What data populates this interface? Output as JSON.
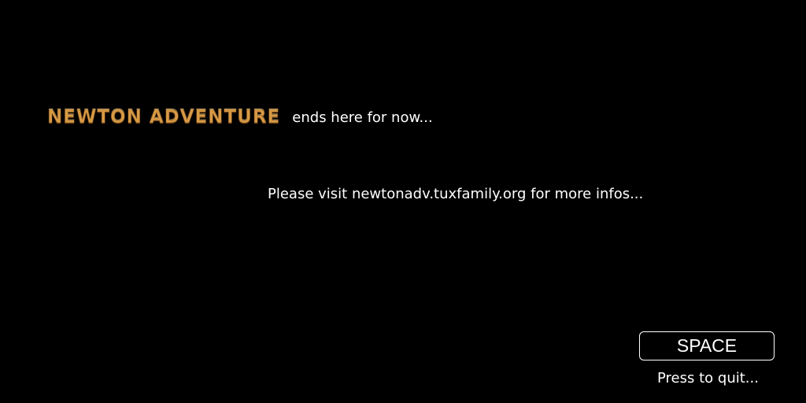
{
  "title": {
    "logo_text": "NEWTON ADVENTURE",
    "suffix": "ends here for now..."
  },
  "message": {
    "visit": "Please visit newtonadv.tuxfamily.org for more infos..."
  },
  "quit": {
    "key_label": "SPACE",
    "hint": "Press to quit..."
  },
  "colors": {
    "background": "#000000",
    "text": "#ffffff",
    "logo": "#d79a45"
  }
}
